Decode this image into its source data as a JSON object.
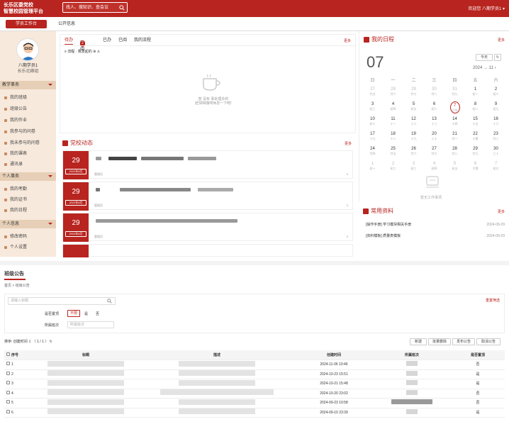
{
  "header": {
    "title_line1": "长乐区委党校",
    "title_line2": "智慧校园管理平台",
    "search_placeholder": "找人、搜知识、查会议",
    "welcome": "欢迎您  八期学员1 ▾"
  },
  "tabs": {
    "workbench": "学员工作台",
    "public": "公开信息"
  },
  "profile": {
    "name": "八期学员1",
    "unit": "长乐北峰组"
  },
  "sidebar": {
    "groups": [
      "教学事务",
      "个人事务",
      "个人信息"
    ],
    "teaching": [
      "我的班级",
      "班级公告",
      "我的作业",
      "我参与的问卷",
      "我未参与的问卷",
      "我的课表",
      "通讯录"
    ],
    "personal": [
      "我的考勤",
      "我的证书",
      "我的日程"
    ],
    "info": [
      "修改密码",
      "个人设置"
    ]
  },
  "todo": {
    "tabs": [
      "待办",
      "待阅",
      "已办",
      "已阅",
      "我的流程"
    ],
    "pending_count": "2",
    "more": "更多",
    "toolbar": "≡ 流程  ·  我发起的  ⊕  ♙",
    "empty_line1": "暂 没有 事处理办的",
    "empty_line2": "赶快喝咖啡休息一下吧!"
  },
  "party": {
    "title": "党校动态",
    "more": "更多",
    "cards": [
      {
        "day": "29",
        "ym": "2024年8月",
        "meta": "管理员",
        "count": "0"
      },
      {
        "day": "29",
        "ym": "2024年8月",
        "meta": "管理员",
        "count": "0"
      },
      {
        "day": "29",
        "ym": "2024年8月",
        "meta": "管理员",
        "count": "0"
      }
    ]
  },
  "schedule": {
    "title": "我的日程",
    "more": "更多",
    "today_btn": "今天",
    "day": "07",
    "month": "2024 → 11 ›",
    "weekdays": [
      "日",
      "一",
      "二",
      "三",
      "四",
      "五",
      "六"
    ],
    "rows": [
      [
        [
          "27",
          "廿五",
          1
        ],
        [
          "28",
          "廿六",
          1
        ],
        [
          "29",
          "廿七",
          1
        ],
        [
          "30",
          "廿八",
          1
        ],
        [
          "31",
          "廿九",
          1
        ],
        [
          "1",
          "初一",
          0
        ],
        [
          "2",
          "初二",
          0
        ]
      ],
      [
        [
          "3",
          "初三",
          0
        ],
        [
          "4",
          "初四",
          0
        ],
        [
          "5",
          "初五",
          0
        ],
        [
          "6",
          "初六",
          0
        ],
        [
          "7",
          "立冬",
          2
        ],
        [
          "8",
          "初八",
          0
        ],
        [
          "9",
          "初九",
          0
        ]
      ],
      [
        [
          "10",
          "初十",
          0
        ],
        [
          "11",
          "十一",
          0
        ],
        [
          "12",
          "十二",
          0
        ],
        [
          "13",
          "十三",
          0
        ],
        [
          "14",
          "十四",
          0
        ],
        [
          "15",
          "十五",
          0
        ],
        [
          "16",
          "十六",
          0
        ]
      ],
      [
        [
          "17",
          "十七",
          0
        ],
        [
          "18",
          "十八",
          0
        ],
        [
          "19",
          "十九",
          0
        ],
        [
          "20",
          "二十",
          0
        ],
        [
          "21",
          "廿一",
          0
        ],
        [
          "22",
          "小雪",
          0
        ],
        [
          "23",
          "廿三",
          0
        ]
      ],
      [
        [
          "24",
          "廿四",
          0
        ],
        [
          "25",
          "廿五",
          0
        ],
        [
          "26",
          "廿六",
          0
        ],
        [
          "27",
          "廿七",
          0
        ],
        [
          "28",
          "廿八",
          0
        ],
        [
          "29",
          "廿九",
          0
        ],
        [
          "30",
          "三十",
          0
        ]
      ],
      [
        [
          "1",
          "初一",
          1
        ],
        [
          "2",
          "初二",
          1
        ],
        [
          "3",
          "初三",
          1
        ],
        [
          "4",
          "初四",
          1
        ],
        [
          "5",
          "初五",
          1
        ],
        [
          "6",
          "大雪",
          1
        ],
        [
          "7",
          "初七",
          1
        ]
      ]
    ],
    "empty": "暂无工作事项"
  },
  "resources": {
    "title": "常用资料",
    "more": "更多",
    "items": [
      {
        "name": "[操作手册] 学习模块相关手册",
        "date": "2024-09-29"
      },
      {
        "name": "[资料模板] 质量表模板",
        "date": "2024-09-29"
      }
    ]
  },
  "announce": {
    "title": "班级公告",
    "breadcrumb": "首页 > 班级公告",
    "search_placeholder": "请输入标题",
    "reset": "重置筛选",
    "filter_top_label": "是否置顶",
    "filter_opts": [
      "不限",
      "是",
      "否"
    ],
    "filter_class_label": "所属班次",
    "filter_class_placeholder": "所属班次",
    "sort": "排序: 创建时间 ⇩   〈  1 / 1  〉  ↻",
    "buttons": [
      "新建",
      "批量删除",
      "发布公告",
      "取消公告"
    ],
    "headers": [
      "序号",
      "标题",
      "描述",
      "创建时间",
      "所属班次",
      "是否置顶"
    ],
    "rows": [
      {
        "no": "1",
        "time": "2024-11-06 10:46",
        "top": "否"
      },
      {
        "no": "2",
        "time": "2024-10-23 15:51",
        "top": "是"
      },
      {
        "no": "3",
        "time": "2024-10-21 15:48",
        "top": "是"
      },
      {
        "no": "4",
        "time": "2024-10-20 23:02",
        "top": "否"
      },
      {
        "no": "5",
        "time": "2024-09-23 10:58",
        "top": "否"
      },
      {
        "no": "6",
        "time": "2024-09-10 23:39",
        "top": "是"
      }
    ]
  }
}
